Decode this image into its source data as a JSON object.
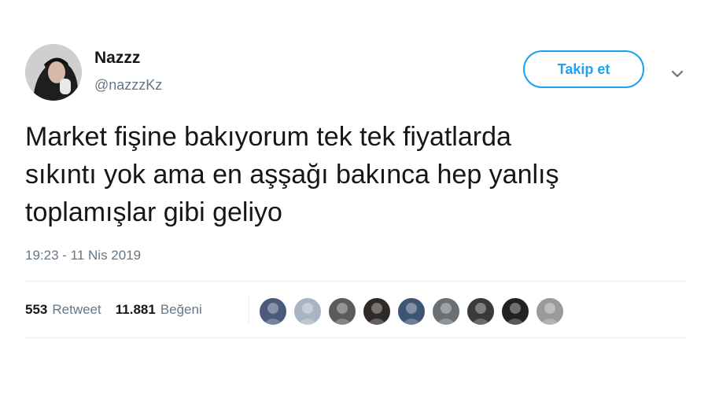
{
  "user": {
    "name": "Nazzz",
    "handle": "@nazzzKz"
  },
  "follow_button_label": "Takip et",
  "tweet": {
    "text": "Market fişine bakıyorum tek tek fiyatlarda\nsıkıntı yok ama en aşşağı bakınca hep yanlış\ntoplamışlar gibi geliyo",
    "timestamp": "19:23 - 11 Nis 2019"
  },
  "stats": {
    "retweet_count": "553",
    "retweet_label": "Retweet",
    "like_count": "11.881",
    "like_label": "Beğeni"
  },
  "likers": [
    {
      "color": "#4a5a78"
    },
    {
      "color": "#a8b4c2"
    },
    {
      "color": "#5b5b5b"
    },
    {
      "color": "#2e2a28"
    },
    {
      "color": "#3e5572"
    },
    {
      "color": "#6b7075"
    },
    {
      "color": "#3a3a3a"
    },
    {
      "color": "#222222"
    },
    {
      "color": "#9a9a9a"
    }
  ],
  "colors": {
    "accent": "#1da1f2",
    "secondary_text": "#657786",
    "primary_text": "#14171a"
  }
}
